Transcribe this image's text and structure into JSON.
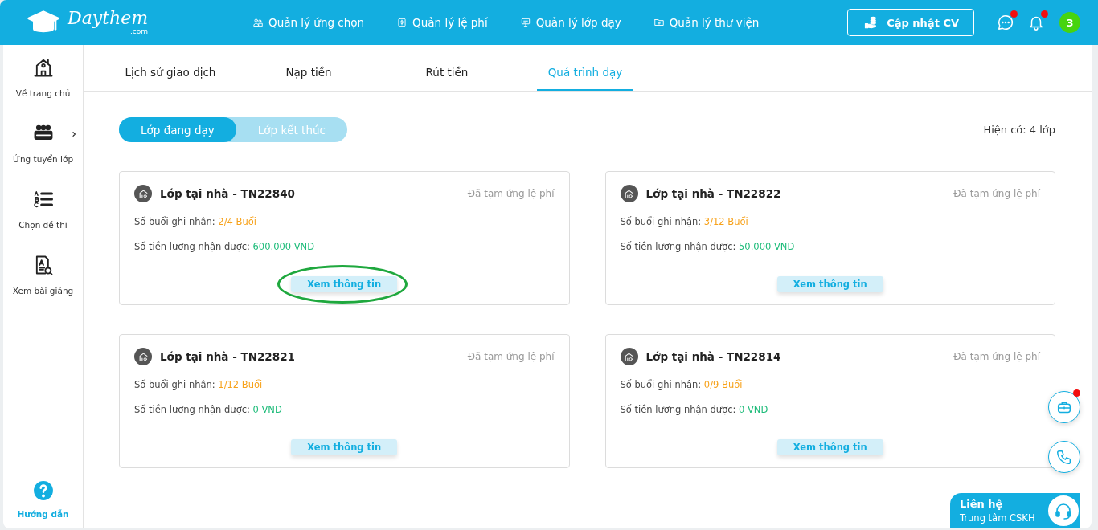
{
  "header": {
    "logo": {
      "name": "Daythem",
      "suffix": ".com"
    },
    "nav": [
      {
        "label": "Quản lý ứng chọn"
      },
      {
        "label": "Quản lý lệ phí"
      },
      {
        "label": "Quản lý lớp dạy"
      },
      {
        "label": "Quản lý thư viện"
      }
    ],
    "cv_button": "Cập nhật CV",
    "chat_unread": true,
    "bell_unread": true,
    "avatar": "3"
  },
  "sidebar": {
    "items": [
      {
        "label": "Về trang chủ",
        "has_submenu": false
      },
      {
        "label": "Ứng tuyển lớp",
        "has_submenu": true
      },
      {
        "label": "Chọn đề thi",
        "has_submenu": false
      },
      {
        "label": "Xem bài giảng",
        "has_submenu": false
      }
    ],
    "help": "Hướng dẫn"
  },
  "tabs": [
    {
      "label": "Lịch sử giao dịch",
      "selected": false
    },
    {
      "label": "Nạp tiền",
      "selected": false
    },
    {
      "label": "Rút tiền",
      "selected": false
    },
    {
      "label": "Quá trình dạy",
      "selected": true
    }
  ],
  "toggle": [
    {
      "label": "Lớp đang dạy",
      "selected": true
    },
    {
      "label": "Lớp kết thúc",
      "selected": false
    }
  ],
  "count": "Hiện có: 4 lớp",
  "classes": [
    {
      "title": "Lớp tại nhà - TN22840",
      "status": "Đã tạm ứng lệ phí",
      "sessions_label": "Số buổi ghi nhận:",
      "sessions": "2/4 Buổi",
      "salary_label": "Số tiền lương nhận được:",
      "salary": "600.000 VND",
      "button": "Xem thông tin",
      "circled": true
    },
    {
      "title": "Lớp tại nhà - TN22822",
      "status": "Đã tạm ứng lệ phí",
      "sessions_label": "Số buổi ghi nhận:",
      "sessions": "3/12 Buổi",
      "salary_label": "Số tiền lương nhận được:",
      "salary": "50.000 VND",
      "button": "Xem thông tin",
      "circled": false
    },
    {
      "title": "Lớp tại nhà - TN22821",
      "status": "Đã tạm ứng lệ phí",
      "sessions_label": "Số buổi ghi nhận:",
      "sessions": "1/12 Buổi",
      "salary_label": "Số tiền lương nhận được:",
      "salary": "0 VND",
      "button": "Xem thông tin",
      "circled": false
    },
    {
      "title": "Lớp tại nhà - TN22814",
      "status": "Đã tạm ứng lệ phí",
      "sessions_label": "Số buổi ghi nhận:",
      "sessions": "0/9 Buổi",
      "salary_label": "Số tiền lương nhận được:",
      "salary": "0 VND",
      "button": "Xem thông tin",
      "circled": false
    }
  ],
  "floating": {
    "briefcase_unread": true,
    "contact_title": "Liên hệ",
    "contact_sub": "Trung tâm CSKH"
  }
}
